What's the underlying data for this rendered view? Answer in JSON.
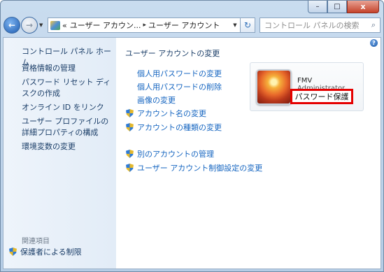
{
  "window": {
    "close_glyph": "x",
    "minimize_glyph": "–",
    "maximize_glyph": "□"
  },
  "nav": {
    "back_glyph": "←",
    "forward_glyph": "→",
    "history_glyph": "▼",
    "refresh_glyph": "↻"
  },
  "address": {
    "overflow": "«",
    "crumb1": "ユーザー アカウン...",
    "separator": "▸",
    "crumb2": "ユーザー アカウント",
    "dropdown_glyph": "▼"
  },
  "search": {
    "placeholder": "コントロール パネルの検索",
    "icon_glyph": "⌕"
  },
  "sidebar": {
    "home": "コントロール パネル ホーム",
    "items": [
      "資格情報の管理",
      "パスワード リセット ディスクの作成",
      "オンライン ID をリンク",
      "ユーザー プロファイルの詳細プロパティの構成",
      "環境変数の変更"
    ],
    "related_heading": "関連項目",
    "parental_controls": "保護者による制限"
  },
  "main": {
    "title": "ユーザー アカウントの変更",
    "help_glyph": "?",
    "tasks": [
      "個人用パスワードの変更",
      "個人用パスワードの削除",
      "画像の変更",
      "アカウント名の変更",
      "アカウントの種類の変更",
      "別のアカウントの管理",
      "ユーザー アカウント制御設定の変更"
    ]
  },
  "account": {
    "name": "FMV",
    "role": "Administrator",
    "status": "パスワード保護"
  },
  "colors": {
    "link": "#1565c0",
    "highlight": "#e50000"
  }
}
